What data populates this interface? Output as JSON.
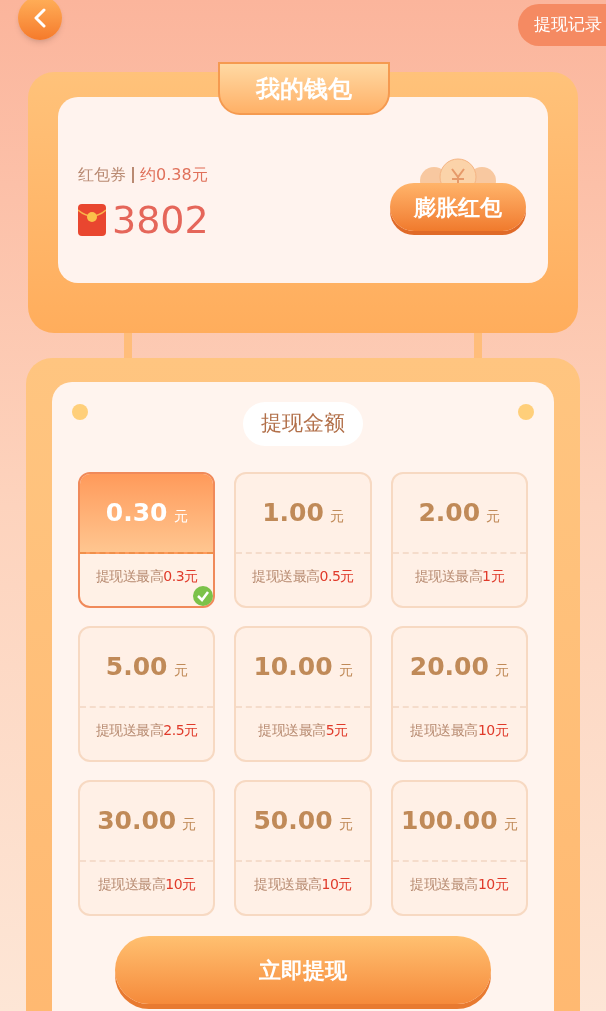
{
  "header": {
    "record_button": "提现记录"
  },
  "wallet": {
    "title": "我的钱包",
    "coupon_label": "红包券",
    "approx": "约0.38元",
    "amount": "3802",
    "inflate_button": "膨胀红包"
  },
  "withdraw": {
    "title": "提现金额",
    "options": [
      {
        "amount": "0.30",
        "unit": "元",
        "bonus_label": "提现送最高",
        "bonus_amount": "0.3元",
        "selected": true
      },
      {
        "amount": "1.00",
        "unit": "元",
        "bonus_label": "提现送最高",
        "bonus_amount": "0.5元",
        "selected": false
      },
      {
        "amount": "2.00",
        "unit": "元",
        "bonus_label": "提现送最高",
        "bonus_amount": "1元",
        "selected": false
      },
      {
        "amount": "5.00",
        "unit": "元",
        "bonus_label": "提现送最高",
        "bonus_amount": "2.5元",
        "selected": false
      },
      {
        "amount": "10.00",
        "unit": "元",
        "bonus_label": "提现送最高",
        "bonus_amount": "5元",
        "selected": false
      },
      {
        "amount": "20.00",
        "unit": "元",
        "bonus_label": "提现送最高",
        "bonus_amount": "10元",
        "selected": false
      },
      {
        "amount": "30.00",
        "unit": "元",
        "bonus_label": "提现送最高",
        "bonus_amount": "10元",
        "selected": false
      },
      {
        "amount": "50.00",
        "unit": "元",
        "bonus_label": "提现送最高",
        "bonus_amount": "10元",
        "selected": false
      },
      {
        "amount": "100.00",
        "unit": "元",
        "bonus_label": "提现送最高",
        "bonus_amount": "10元",
        "selected": false
      }
    ],
    "submit_button": "立即提现"
  }
}
